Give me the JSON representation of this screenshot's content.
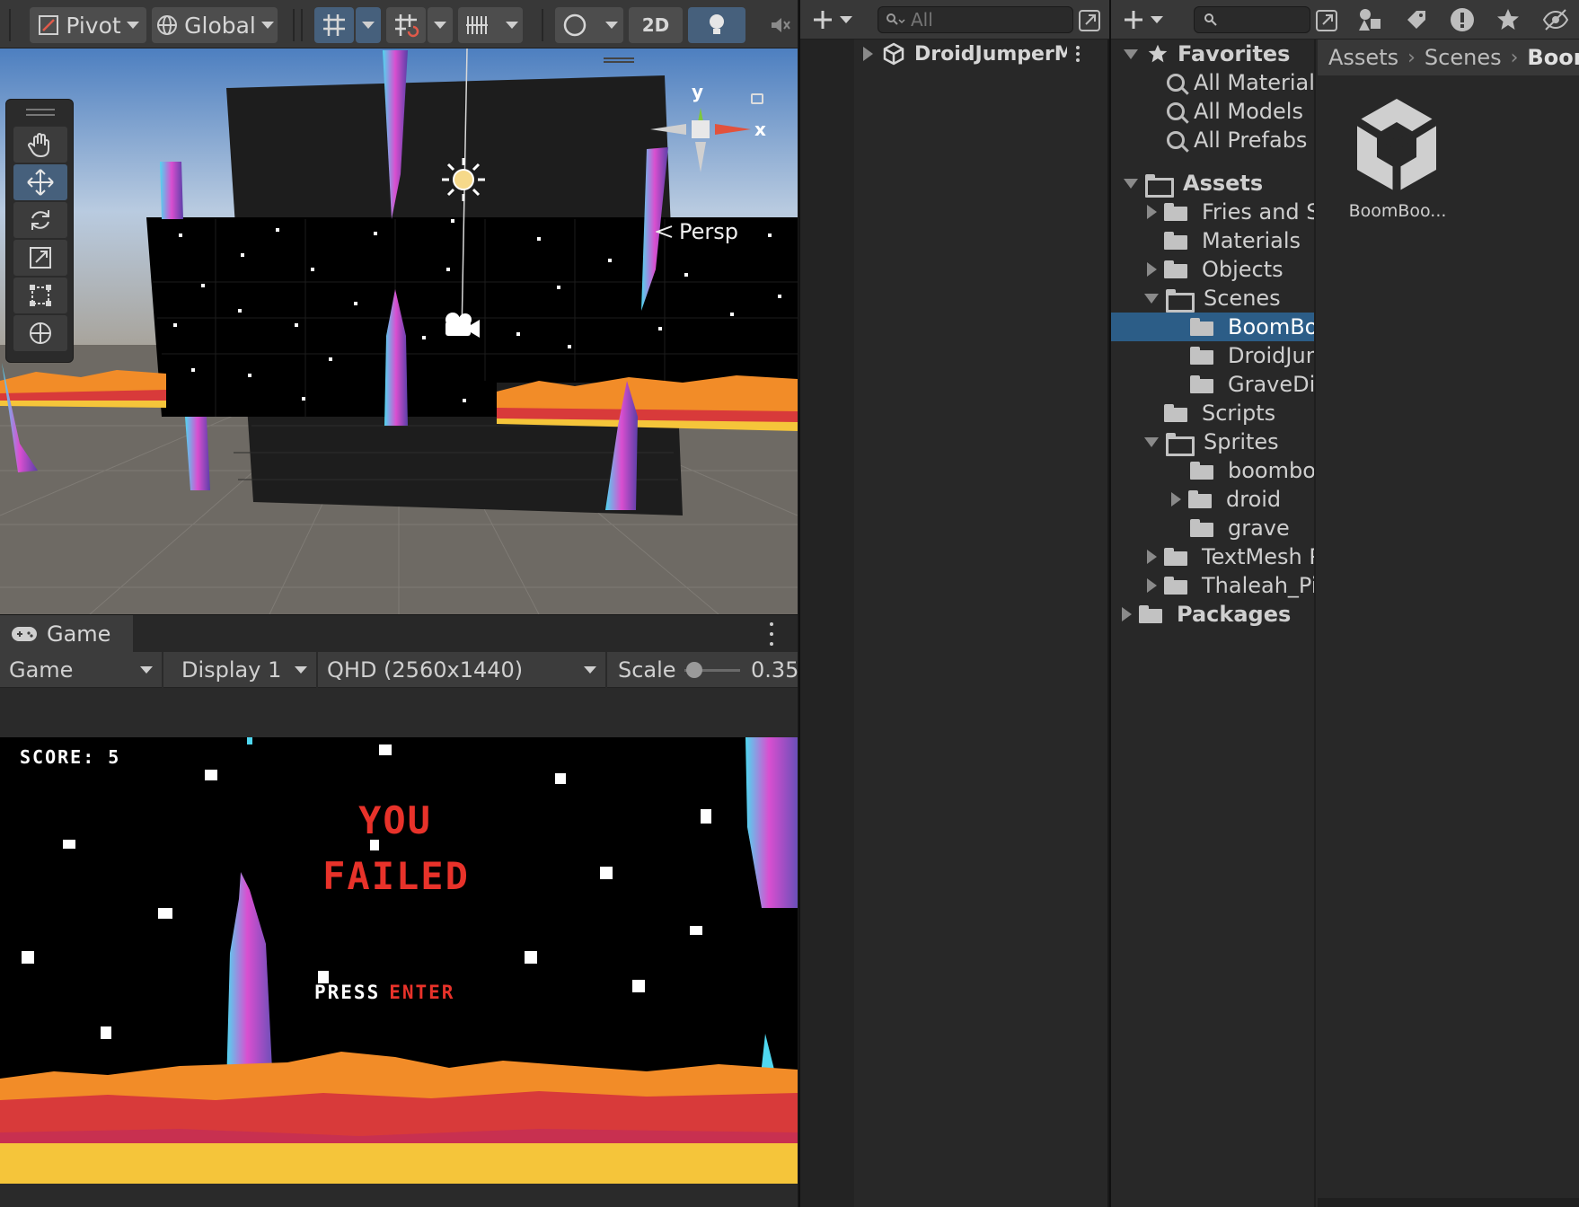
{
  "scene_toolbar": {
    "pivot_label": "Pivot",
    "global_label": "Global",
    "mode_2d_label": "2D"
  },
  "scene_view": {
    "persp_label": "Persp",
    "gizmo_x_label": "x",
    "gizmo_y_label": "y"
  },
  "game_view": {
    "tab_label": "Game",
    "view_select": "Game",
    "display_select": "Display 1",
    "resolution_select": "QHD (2560x1440)",
    "scale_label": "Scale",
    "scale_value": "0.35",
    "score_text": "SCORE: 5",
    "fail_line1": "YOU",
    "fail_line2": "FAILED",
    "press_label": "PRESS",
    "enter_label": "ENTER"
  },
  "hierarchy": {
    "search_placeholder": "All",
    "scene_name": "DroidJumperM"
  },
  "project": {
    "favorites_label": "Favorites",
    "favorites": [
      "All Material",
      "All Models",
      "All Prefabs"
    ],
    "assets_label": "Assets",
    "tree": [
      "Fries and Sc",
      "Materials",
      "Objects",
      "Scenes",
      "BoomBoo",
      "DroidJum",
      "GraveDig",
      "Scripts",
      "Sprites",
      "boombod",
      "droid",
      "grave",
      "TextMesh P",
      "Thaleah_Pix"
    ],
    "packages_label": "Packages",
    "breadcrumb": [
      "Assets",
      "Scenes",
      "Boom"
    ],
    "asset_item_label": "BoomBoo..."
  },
  "colors": {
    "accent_selected": "#2c5d87",
    "fail_red": "#e8322a",
    "lava_orange": "#f28c28",
    "lava_yellow": "#f5c53a",
    "crystal_cyan": "#4fd7f0",
    "crystal_magenta": "#d94fd0"
  }
}
